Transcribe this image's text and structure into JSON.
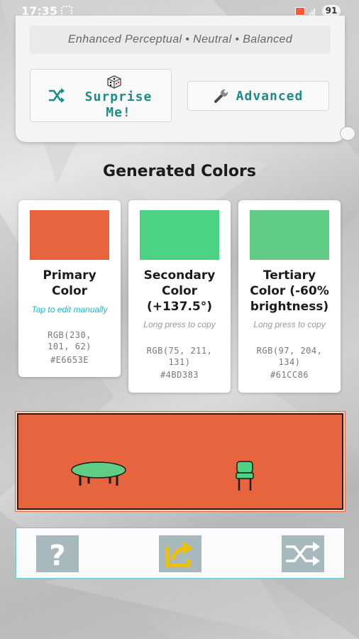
{
  "status_bar": {
    "time": "17:35",
    "battery": "91"
  },
  "top_card": {
    "mode_summary": "Enhanced Perceptual • Neutral • Balanced",
    "surprise_button": {
      "label": "Surprise\nMe!",
      "icons": [
        "shuffle-icon",
        "dice-icon"
      ]
    },
    "advanced_button": {
      "label": "Advanced",
      "icon": "wrench-icon"
    }
  },
  "section_title": "Generated Colors",
  "colors": [
    {
      "name": "Primary\nColor",
      "hint": "Tap to edit manually",
      "rgb": "RGB(230,\n101, 62)",
      "hex": "#E6653E",
      "swatch": "#E6653E",
      "hint_color": "#1fb8c9"
    },
    {
      "name": "Secondary\nColor\n(+137.5°)",
      "hint": "Long press to copy",
      "rgb": "RGB(75, 211,\n131)",
      "hex": "#4BD383",
      "swatch": "#4BD383",
      "hint_color": "#999999"
    },
    {
      "name": "Tertiary\nColor (-60%\nbrightness)",
      "hint": "Long press to copy",
      "rgb": "RGB(97, 204,\n134)",
      "hex": "#61CC86",
      "swatch": "#61CC86",
      "hint_color": "#999999"
    }
  ],
  "preview": {
    "wall_color": "#E6653E",
    "furniture": [
      "table-icon",
      "chair-icon"
    ]
  },
  "bottom_bar": {
    "buttons": [
      "help-icon",
      "share-icon",
      "shuffle-icon"
    ],
    "share_color": "#f0c000"
  }
}
